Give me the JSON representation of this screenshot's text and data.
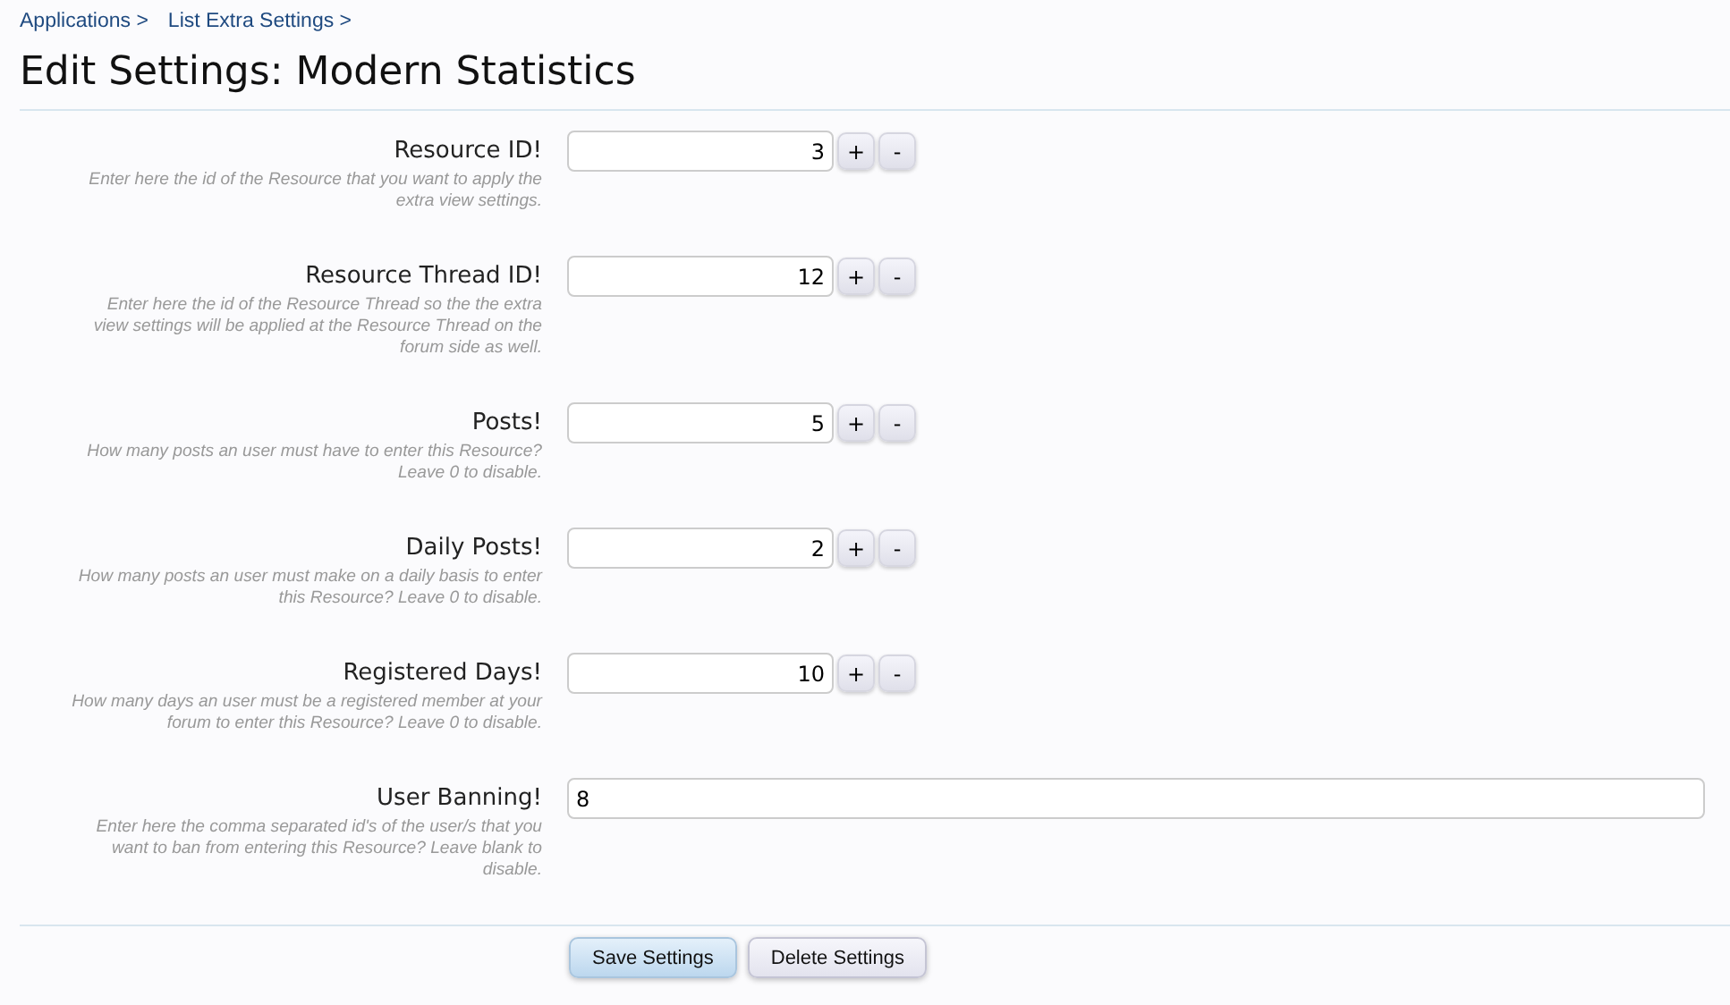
{
  "breadcrumbs": [
    "Applications >",
    "List Extra Settings >"
  ],
  "title": "Edit Settings: Modern Statistics",
  "fields": [
    {
      "kind": "spinner",
      "label": "Resource ID!",
      "hint": "Enter here the id of the Resource that you want to apply the extra view settings.",
      "value": "3",
      "plus": "+",
      "minus": "-"
    },
    {
      "kind": "spinner",
      "label": "Resource Thread ID!",
      "hint": "Enter here the id of the Resource Thread so the the extra view settings will be applied at the Resource Thread on the forum side as well.",
      "value": "12",
      "plus": "+",
      "minus": "-"
    },
    {
      "kind": "spinner",
      "label": "Posts!",
      "hint": "How many posts an user must have to enter this Resource? Leave 0 to disable.",
      "value": "5",
      "plus": "+",
      "minus": "-"
    },
    {
      "kind": "spinner",
      "label": "Daily Posts!",
      "hint": "How many posts an user must make on a daily basis to enter this Resource? Leave 0 to disable.",
      "value": "2",
      "plus": "+",
      "minus": "-"
    },
    {
      "kind": "spinner",
      "label": "Registered Days!",
      "hint": "How many days an user must be a registered member at your forum to enter this Resource? Leave 0 to disable.",
      "value": "10",
      "plus": "+",
      "minus": "-"
    },
    {
      "kind": "text",
      "label": "User Banning!",
      "hint": "Enter here the comma separated id's of the user/s that you want to ban from entering this Resource? Leave blank to disable.",
      "value": "8"
    }
  ],
  "buttons": [
    {
      "label": "Save Settings",
      "kind": "primary"
    },
    {
      "label": "Delete Settings",
      "kind": "secondary"
    }
  ]
}
